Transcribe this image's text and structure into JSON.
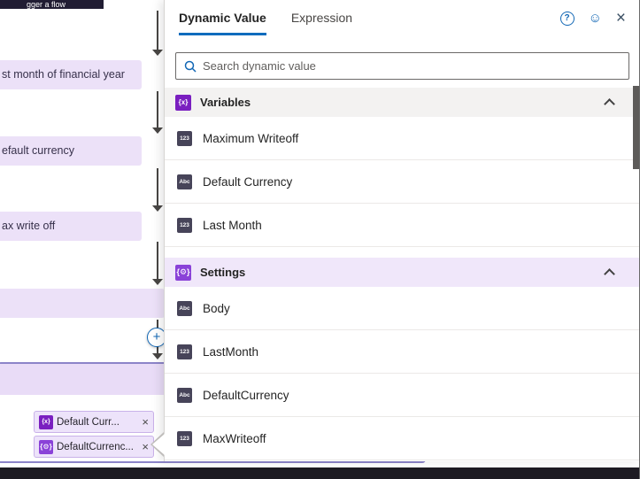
{
  "colors": {
    "accent_blue": "#0f6cbd",
    "variables_purple": "#7a1fc0",
    "settings_purple": "#8a42d8",
    "flow_card_purple": "#ece1f8",
    "settings_section_bg": "#f0e7fa",
    "variables_section_bg": "#f3f2f1"
  },
  "canvas": {
    "top_bar_text": "gger a flow",
    "cards": [
      {
        "label": "st month of financial year"
      },
      {
        "label": "efault currency"
      },
      {
        "label": "ax write off"
      }
    ],
    "add_button_label": "+",
    "selected_card": {
      "chips": [
        {
          "icon": "variables-icon",
          "glyph": "{x}",
          "label": "Default Curr...",
          "close_glyph": "×"
        },
        {
          "icon": "settings-icon",
          "glyph": "{⚙}",
          "label": "DefaultCurrenc...",
          "close_glyph": "×"
        }
      ]
    }
  },
  "panel": {
    "tabs": [
      {
        "label": "Dynamic Value",
        "active": true
      },
      {
        "label": "Expression",
        "active": false
      }
    ],
    "header_icons": {
      "help": "?",
      "feedback": "☺",
      "close": "×"
    },
    "search": {
      "placeholder": "Search dynamic value"
    },
    "sections": [
      {
        "title": "Variables",
        "icon_glyph": "{x}",
        "items": [
          {
            "type": "123",
            "label": "Maximum Writeoff"
          },
          {
            "type": "Abc",
            "label": "Default Currency"
          },
          {
            "type": "123",
            "label": "Last Month"
          }
        ]
      },
      {
        "title": "Settings",
        "icon_glyph": "{⚙}",
        "items": [
          {
            "type": "Abc",
            "label": "Body"
          },
          {
            "type": "123",
            "label": "LastMonth"
          },
          {
            "type": "Abc",
            "label": "DefaultCurrency"
          },
          {
            "type": "123",
            "label": "MaxWriteoff"
          }
        ]
      }
    ]
  }
}
